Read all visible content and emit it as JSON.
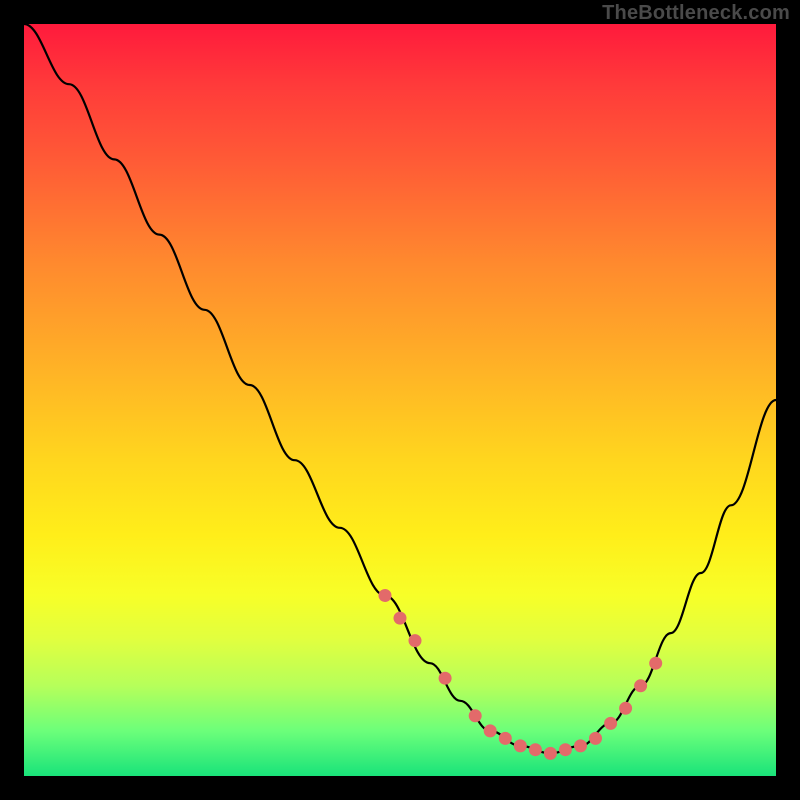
{
  "attribution": "TheBottleneck.com",
  "chart_data": {
    "type": "line",
    "title": "",
    "xlabel": "",
    "ylabel": "",
    "xlim": [
      0,
      100
    ],
    "ylim": [
      0,
      100
    ],
    "series": [
      {
        "name": "bottleneck-curve",
        "x": [
          0,
          6,
          12,
          18,
          24,
          30,
          36,
          42,
          48,
          54,
          58,
          62,
          66,
          70,
          74,
          78,
          82,
          86,
          90,
          94,
          100
        ],
        "y": [
          100,
          92,
          82,
          72,
          62,
          52,
          42,
          33,
          24,
          15,
          10,
          6,
          4,
          3,
          4,
          7,
          12,
          19,
          27,
          36,
          50
        ]
      }
    ],
    "markers": {
      "name": "highlight-points",
      "color": "#e36a6a",
      "x": [
        48,
        50,
        52,
        56,
        60,
        62,
        64,
        66,
        68,
        70,
        72,
        74,
        76,
        78,
        80,
        82,
        84
      ],
      "y": [
        24,
        21,
        18,
        13,
        8,
        6,
        5,
        4,
        3.5,
        3,
        3.5,
        4,
        5,
        7,
        9,
        12,
        15
      ]
    }
  }
}
